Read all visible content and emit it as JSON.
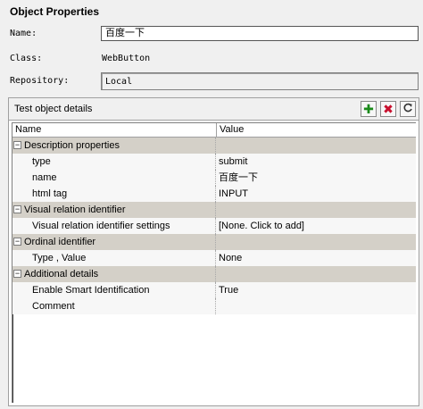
{
  "header": {
    "title": "Object Properties"
  },
  "fields": {
    "name_label": "Name:",
    "name_value": "百度一下",
    "class_label": "Class:",
    "class_value": "WebButton",
    "repository_label": "Repository:",
    "repository_value": "Local"
  },
  "details": {
    "title": "Test object details",
    "add_icon": "plus-icon",
    "remove_icon": "x-icon",
    "refresh_icon": "refresh-icon",
    "columns": {
      "name": "Name",
      "value": "Value"
    },
    "categories": [
      {
        "label": "Description properties",
        "expander": "−",
        "items": [
          {
            "name": "type",
            "value": "submit"
          },
          {
            "name": "name",
            "value": "百度一下"
          },
          {
            "name": "html tag",
            "value": "INPUT"
          }
        ]
      },
      {
        "label": "Visual relation identifier",
        "expander": "−",
        "items": [
          {
            "name": "Visual relation identifier settings",
            "value": "[None. Click to add]"
          }
        ]
      },
      {
        "label": "Ordinal identifier",
        "expander": "−",
        "items": [
          {
            "name": "Type , Value",
            "value": "None"
          }
        ]
      },
      {
        "label": "Additional details",
        "expander": "−",
        "items": [
          {
            "name": "Enable Smart Identification",
            "value": "True"
          },
          {
            "name": "Comment",
            "value": ""
          }
        ]
      }
    ]
  }
}
